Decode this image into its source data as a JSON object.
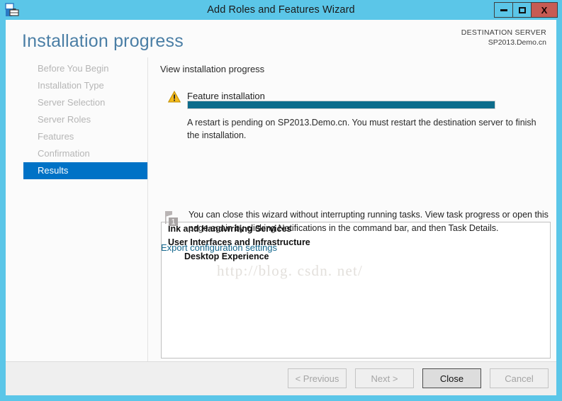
{
  "window": {
    "title": "Add Roles and Features Wizard",
    "icon": "server-manager-icon",
    "controls": {
      "minimize": "minimize-icon",
      "maximize": "maximize-icon",
      "close": "X"
    },
    "frame_color": "#5BC6E8",
    "close_color": "#C75B53"
  },
  "header": {
    "page_title": "Installation progress",
    "destination_label": "DESTINATION SERVER",
    "destination_value": "SP2013.Demo.cn",
    "title_color": "#4A7EA5"
  },
  "sidebar": {
    "items": [
      {
        "label": "Before You Begin",
        "selected": false
      },
      {
        "label": "Installation Type",
        "selected": false
      },
      {
        "label": "Server Selection",
        "selected": false
      },
      {
        "label": "Server Roles",
        "selected": false
      },
      {
        "label": "Features",
        "selected": false
      },
      {
        "label": "Confirmation",
        "selected": false
      },
      {
        "label": "Results",
        "selected": true
      }
    ],
    "selected_color": "#0072C6",
    "disabled_color": "#B6B6B6"
  },
  "content": {
    "heading": "View installation progress",
    "status": {
      "icon": "warning-icon",
      "icon_color": "#F5B700",
      "label": "Feature installation"
    },
    "progress": {
      "percent": 100,
      "fill_color": "#0D6C8B"
    },
    "restart_message": "A restart is pending on SP2013.Demo.cn. You must restart the destination server to finish the installation.",
    "results": [
      {
        "text": "Ink and Handwriting Services",
        "indent": 0
      },
      {
        "text": "User Interfaces and Infrastructure",
        "indent": 0
      },
      {
        "text": "Desktop Experience",
        "indent": 1
      }
    ],
    "watermark": "http://blog. csdn. net/",
    "notice": {
      "icon": "notification-flag-icon",
      "badge": "1",
      "text": "You can close this wizard without interrupting running tasks. View task progress or open this page again by clicking Notifications in the command bar, and then Task Details."
    },
    "export_link": "Export configuration settings",
    "link_color": "#15688E"
  },
  "footer": {
    "buttons": [
      {
        "label": "< Previous",
        "enabled": false,
        "default": false
      },
      {
        "label": "Next >",
        "enabled": false,
        "default": false
      },
      {
        "label": "Close",
        "enabled": true,
        "default": true
      },
      {
        "label": "Cancel",
        "enabled": false,
        "default": false
      }
    ]
  }
}
